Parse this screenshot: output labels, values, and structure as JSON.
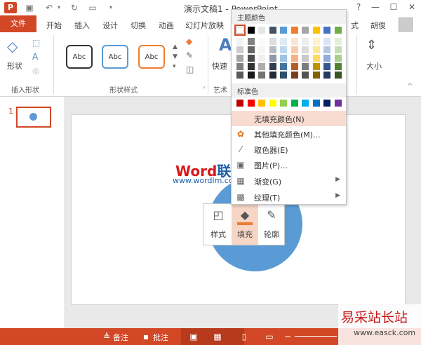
{
  "titlebar": {
    "app_logo": "P",
    "title": "演示文稿1 - PowerPoint",
    "qat_icons": [
      "save-icon",
      "undo-icon",
      "repeat-icon",
      "present-icon"
    ],
    "window_buttons": [
      "?",
      "—",
      "☐",
      "✕"
    ]
  },
  "tabs": {
    "file": "文件",
    "items": [
      "开始",
      "插入",
      "设计",
      "切换",
      "动画",
      "幻灯片放映"
    ],
    "trailing_tab": "式",
    "user": "胡俊"
  },
  "ribbon": {
    "groups": {
      "insert_shapes": "插入形状",
      "shape_styles": "形状样式",
      "art": "艺术",
      "arrange": "大小"
    },
    "shape_label": "形状",
    "style_box_text": "Abc",
    "quick_style_label": "快速",
    "size_label": "大小"
  },
  "slide_panel": {
    "slide_number": "1"
  },
  "watermark": {
    "brand_red": "Word",
    "brand_blue": "联盟",
    "url": "www.wordlm.com"
  },
  "dropdown": {
    "theme_colors_label": "主题颜色",
    "theme_colors_top": [
      "#ffffff",
      "#000000",
      "#e7e6e6",
      "#44546a",
      "#5b9bd5",
      "#ed7d31",
      "#a5a5a5",
      "#ffc000",
      "#4472c4",
      "#70ad47"
    ],
    "standard_colors_label": "标准色",
    "standard_colors": [
      "#c00000",
      "#ff0000",
      "#ffc000",
      "#ffff00",
      "#92d050",
      "#00b050",
      "#00b0f0",
      "#0070c0",
      "#002060",
      "#7030a0"
    ],
    "items": [
      {
        "label": "无填充颜色(N)",
        "icon": "no-fill-icon",
        "submenu": false,
        "highlighted": true
      },
      {
        "label": "其他填充颜色(M)...",
        "icon": "color-wheel-icon",
        "submenu": false,
        "highlighted": false
      },
      {
        "label": "取色器(E)",
        "icon": "eyedropper-icon",
        "submenu": false,
        "highlighted": false
      },
      {
        "label": "图片(P)...",
        "icon": "picture-icon",
        "submenu": false,
        "highlighted": false
      },
      {
        "label": "渐变(G)",
        "icon": "gradient-icon",
        "submenu": true,
        "highlighted": false
      },
      {
        "label": "纹理(T)",
        "icon": "texture-icon",
        "submenu": true,
        "highlighted": false
      }
    ]
  },
  "minibar": {
    "style": "样式",
    "fill": "填充",
    "outline": "轮廓"
  },
  "statusbar": {
    "notes": "备注",
    "comments": "批注"
  },
  "site_logo": {
    "name": "易采站长站",
    "url": "www.easck.com"
  },
  "colors": {
    "accent": "#d24726",
    "shape_fill": "#5b9bd5"
  }
}
